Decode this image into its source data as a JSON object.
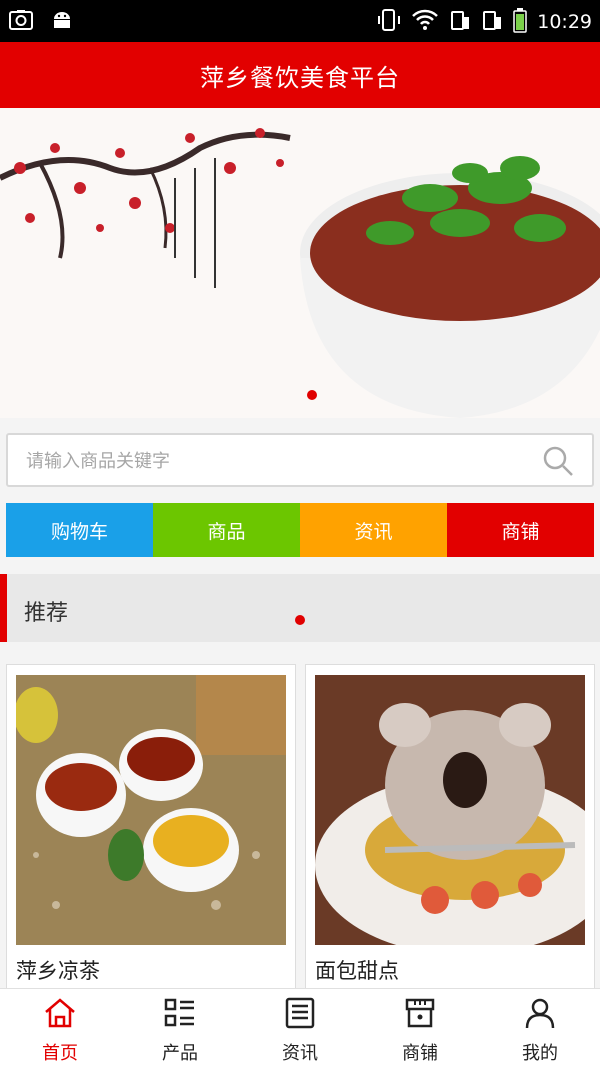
{
  "status_bar": {
    "time": "10:29"
  },
  "header": {
    "title": "萍乡餐饮美食平台"
  },
  "search": {
    "placeholder": "请输入商品关键字"
  },
  "quick_nav": [
    {
      "label": "购物车",
      "color": "#1aa0e8"
    },
    {
      "label": "商品",
      "color": "#6cc600"
    },
    {
      "label": "资讯",
      "color": "#ffa200"
    },
    {
      "label": "商铺",
      "color": "#e20000"
    }
  ],
  "section": {
    "title": "推荐"
  },
  "products": [
    {
      "name": "萍乡凉茶"
    },
    {
      "name": "面包甜点"
    }
  ],
  "tabs": [
    {
      "label": "首页",
      "icon": "home-icon",
      "active": true
    },
    {
      "label": "产品",
      "icon": "list-icon",
      "active": false
    },
    {
      "label": "资讯",
      "icon": "news-icon",
      "active": false
    },
    {
      "label": "商铺",
      "icon": "store-icon",
      "active": false
    },
    {
      "label": "我的",
      "icon": "user-icon",
      "active": false
    }
  ],
  "colors": {
    "brand": "#e20000"
  }
}
